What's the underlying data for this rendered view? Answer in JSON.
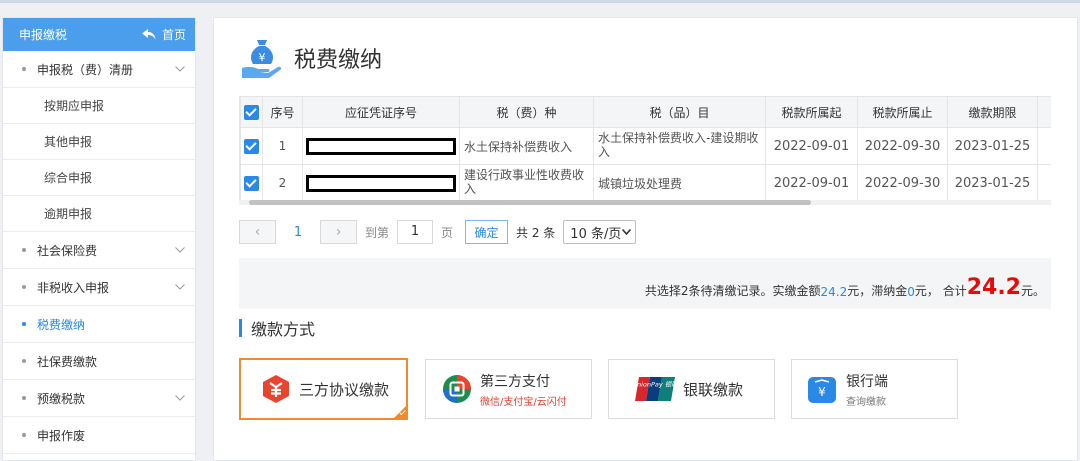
{
  "colors": {
    "accent": "#2a89e5",
    "sidebar_header": "#4a9eeb",
    "selected_border": "#f08a2c",
    "amount_red": "#e50b0b"
  },
  "sidebar": {
    "title": "申报缴税",
    "home_label": "首页",
    "items": [
      {
        "label": "申报税（费）清册"
      },
      {
        "label": "按期应申报"
      },
      {
        "label": "其他申报"
      },
      {
        "label": "综合申报"
      },
      {
        "label": "逾期申报"
      },
      {
        "label": "社会保险费"
      },
      {
        "label": "非税收入申报"
      },
      {
        "label": "税费缴纳"
      },
      {
        "label": "社保费缴款"
      },
      {
        "label": "预缴税款"
      },
      {
        "label": "申报作废"
      }
    ]
  },
  "main": {
    "title": "税费缴纳",
    "table": {
      "headers": [
        "序号",
        "应征凭证序号",
        "税（费）种",
        "税（品）目",
        "税款所属起",
        "税款所属止",
        "缴款期限"
      ],
      "rows": [
        {
          "no": "1",
          "tax_type": "水土保持补偿费收入",
          "item": "水土保持补偿费收入-建设期收入",
          "start": "2022-09-01",
          "end": "2022-09-30",
          "deadline": "2023-01-25"
        },
        {
          "no": "2",
          "tax_type": "建设行政事业性收费收入",
          "item": "城镇垃圾处理费",
          "start": "2022-09-01",
          "end": "2022-09-30",
          "deadline": "2023-01-25"
        }
      ]
    },
    "pager": {
      "prev": "‹",
      "next": "›",
      "current_page": "1",
      "goto_label": "到第",
      "goto_value": "1",
      "page_unit": "页",
      "confirm": "确定",
      "total": "共 2 条",
      "page_size": "10 条/页"
    },
    "summary": {
      "part1": "共选择2条待清缴记录。实缴金额",
      "paid": "24.2",
      "part2": " 元，滞纳金 ",
      "late_fee": "0",
      "part3": "元， 合计",
      "total": "24.2",
      "part4": "元。"
    },
    "payment": {
      "title": "缴款方式",
      "methods": [
        {
          "label": "三方协议缴款",
          "sub": ""
        },
        {
          "label": "第三方支付",
          "sub": "微信/支付宝/云闪付"
        },
        {
          "label": "银联缴款",
          "sub": ""
        },
        {
          "label": "银行端",
          "sub": "查询缴款"
        }
      ],
      "unionpay_logo_text": "UnionPay 银联"
    }
  }
}
